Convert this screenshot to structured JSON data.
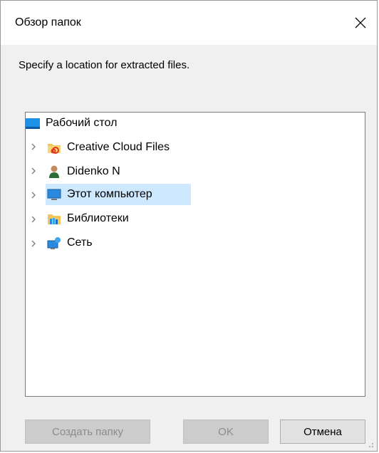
{
  "window": {
    "title": "Обзор папок",
    "close_icon": "close-icon"
  },
  "instruction": "Specify a location for extracted files.",
  "tree": {
    "root": {
      "label": "Рабочий стол",
      "icon": "desktop-icon"
    },
    "items": [
      {
        "label": "Creative Cloud Files",
        "icon": "creative-cloud-folder-icon",
        "selected": false
      },
      {
        "label": "Didenko N",
        "icon": "user-folder-icon",
        "selected": false
      },
      {
        "label": "Этот компьютер",
        "icon": "computer-icon",
        "selected": true
      },
      {
        "label": "Библиотеки",
        "icon": "libraries-icon",
        "selected": false
      },
      {
        "label": "Сеть",
        "icon": "network-icon",
        "selected": false
      }
    ]
  },
  "buttons": {
    "new_folder": "Создать папку",
    "ok": "OK",
    "cancel": "Отмена"
  },
  "colors": {
    "selection": "#cde8ff",
    "dialog_bg": "#f0f0f0",
    "border": "#7a7a7a"
  }
}
